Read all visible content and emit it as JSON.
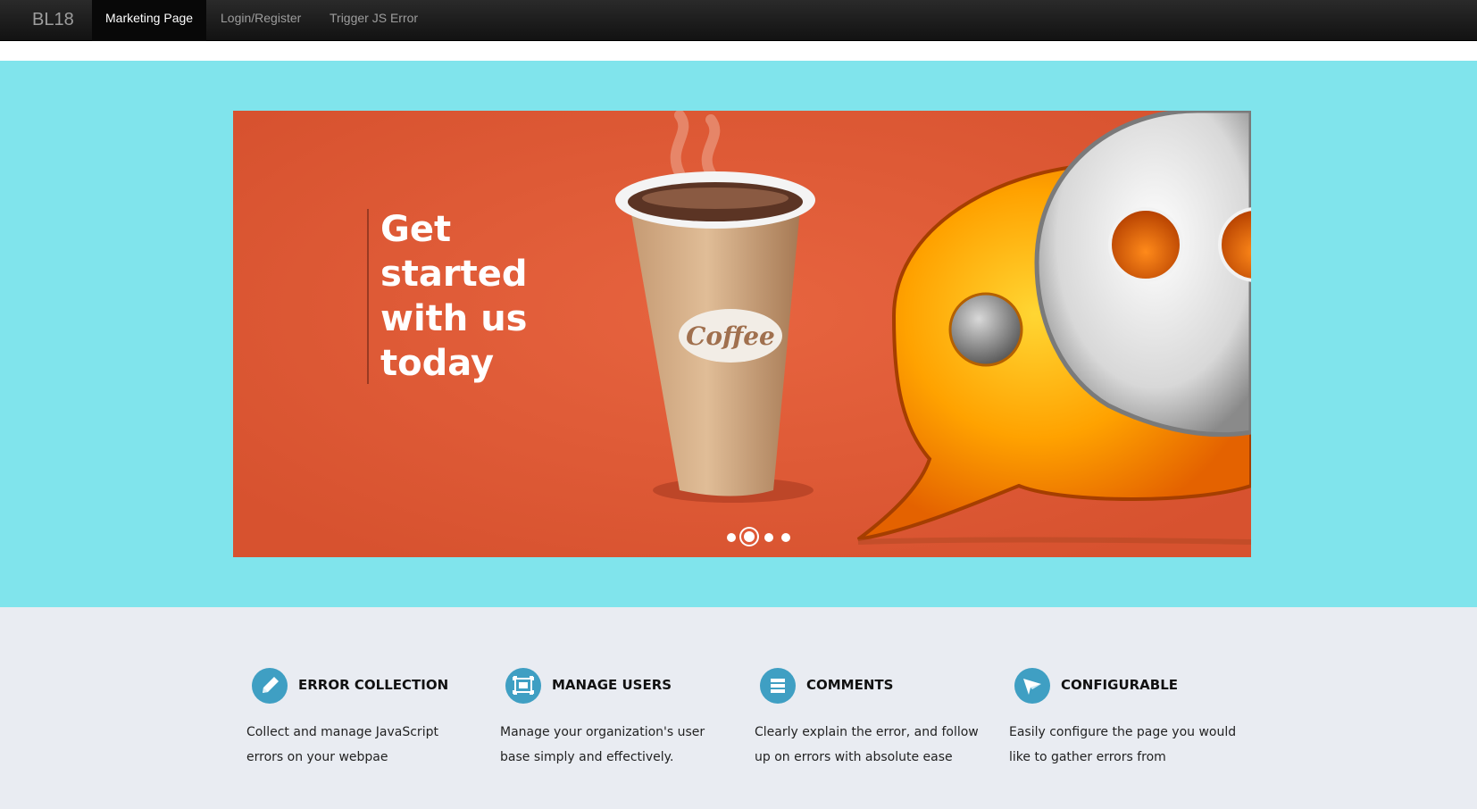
{
  "navbar": {
    "brand": "BL18",
    "items": [
      {
        "label": "Marketing Page",
        "active": true
      },
      {
        "label": "Login/Register",
        "active": false
      },
      {
        "label": "Trigger JS Error",
        "active": false
      }
    ]
  },
  "hero": {
    "background": "#80e4ec",
    "banner_color": "#df5937",
    "headline": "Get started with us today",
    "cup_label": "Coffee",
    "slides": {
      "count": 4,
      "active_index": 1
    }
  },
  "features": [
    {
      "icon": "pencil-icon",
      "title": "ERROR COLLECTION",
      "description": "Collect and manage JavaScript errors on your webpae"
    },
    {
      "icon": "screen-icon",
      "title": "MANAGE USERS",
      "description": "Manage your organization's user base simply and effectively."
    },
    {
      "icon": "list-icon",
      "title": "COMMENTS",
      "description": "Clearly explain the error, and follow up on errors with absolute ease"
    },
    {
      "icon": "paper-plane-icon",
      "title": "CONFIGURABLE",
      "description": "Easily configure the page you would like to gather errors from"
    }
  ],
  "colors": {
    "accent": "#3f9fc3",
    "features_bg": "#e9ecf2",
    "navbar_bg": "#1b1b1b"
  }
}
